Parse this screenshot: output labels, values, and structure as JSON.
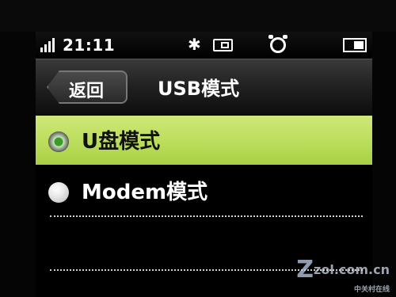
{
  "status_bar": {
    "time": "21:11",
    "icons": [
      "signal-icon",
      "bluetooth-icon",
      "memory-card-icon",
      "alarm-icon",
      "battery-icon"
    ]
  },
  "header": {
    "back_label": "返回",
    "title": "USB模式"
  },
  "options": [
    {
      "label": "U盘模式",
      "selected": true
    },
    {
      "label": "Modem模式",
      "selected": false
    }
  ],
  "watermark": {
    "text": "zol.com.cn",
    "subtext": "中关村在线"
  },
  "colors": {
    "selected_bg": "#b9dc59",
    "background": "#000000",
    "text": "#ffffff"
  }
}
